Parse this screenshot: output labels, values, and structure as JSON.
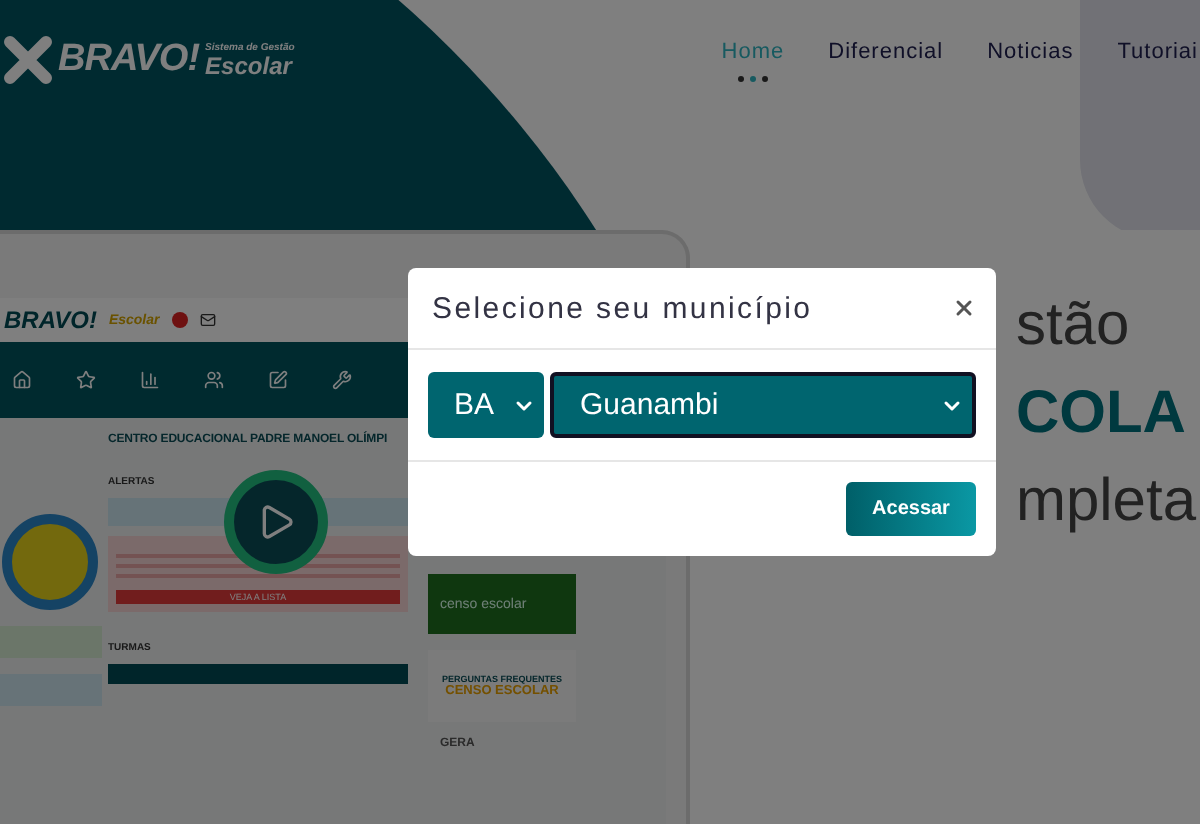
{
  "brand": {
    "name": "BRAVO!",
    "tagline": "Sistema de Gestão",
    "product": "Escolar"
  },
  "nav": [
    {
      "label": "Home",
      "selected": true
    },
    {
      "label": "Diferencial",
      "selected": false
    },
    {
      "label": "Noticias",
      "selected": false
    },
    {
      "label": "Tutoriai",
      "selected": false
    }
  ],
  "preview": {
    "brand": "BRAVO!",
    "product": "Escolar",
    "school": "CENTRO EDUCACIONAL PADRE MANOEL OLÍMPI",
    "alerts_title": "ALERTAS",
    "classes_title": "TURMAS",
    "alert_button": "VEJA A LISTA",
    "census_card": "censo escolar",
    "faq_title": "PERGUNTAS FREQUENTES",
    "faq_subtitle": "CENSO ESCOLAR",
    "last_card": "GERA"
  },
  "hero": [
    {
      "text": "stão",
      "kind": "plain"
    },
    {
      "text": "COLA",
      "kind": "accent"
    },
    {
      "text": "mpleta",
      "kind": "plain"
    }
  ],
  "modal": {
    "title": "Selecione seu município",
    "state": "BA",
    "city": "Guanambi",
    "submit": "Acessar"
  }
}
